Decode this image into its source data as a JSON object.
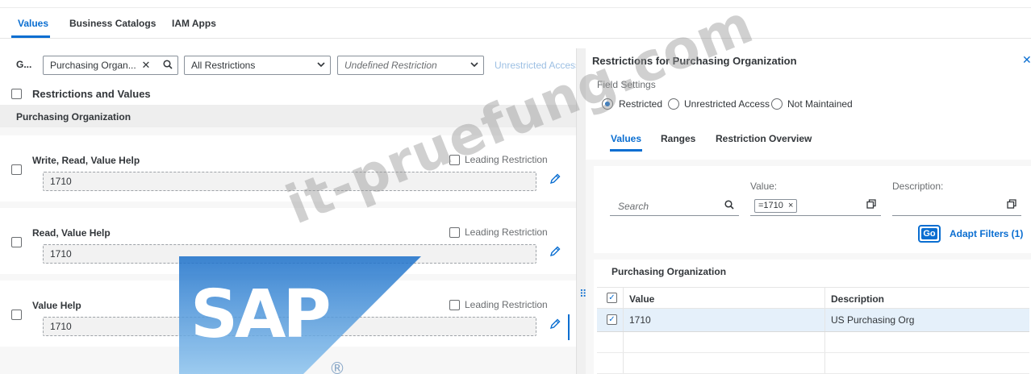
{
  "top_tabs": [
    {
      "label": "Values",
      "active": true
    },
    {
      "label": "Business Catalogs",
      "active": false
    },
    {
      "label": "IAM Apps",
      "active": false
    }
  ],
  "filterbar": {
    "group_label": "G...",
    "field_value": "Purchasing Organ...",
    "restrictions_select": "All Restrictions",
    "restriction_type_placeholder": "Undefined Restriction",
    "unrestricted_access": "Unrestricted Access"
  },
  "left": {
    "header": "Restrictions and Values",
    "section": "Purchasing Organization",
    "rows": [
      {
        "label": "Write, Read, Value Help",
        "leading": "Leading Restriction",
        "value": "1710"
      },
      {
        "label": "Read, Value Help",
        "leading": "Leading Restriction",
        "value": "1710"
      },
      {
        "label": "Value Help",
        "leading": "Leading Restriction",
        "value": "1710"
      }
    ]
  },
  "right": {
    "title": "Restrictions for Purchasing Organization",
    "field_settings": "Field Settings",
    "radios": [
      {
        "label": "Restricted",
        "selected": true
      },
      {
        "label": "Unrestricted Access",
        "selected": false
      },
      {
        "label": "Not Maintained",
        "selected": false
      }
    ],
    "tabs": [
      {
        "label": "Values",
        "active": true
      },
      {
        "label": "Ranges",
        "active": false
      },
      {
        "label": "Restriction Overview",
        "active": false
      }
    ],
    "filters": {
      "search_placeholder": "Search",
      "value_label": "Value:",
      "value_token": "=1710",
      "description_label": "Description:",
      "go": "Go",
      "adapt": "Adapt Filters (1)"
    },
    "table": {
      "title": "Purchasing Organization",
      "columns": [
        "Value",
        "Description"
      ],
      "rows": [
        {
          "value": "1710",
          "description": "US Purchasing Org",
          "selected": true
        }
      ]
    }
  },
  "watermark": {
    "text": "it-pruefung.com",
    "logo_text": "SAP",
    "registered": "®"
  },
  "colors": {
    "accent": "#0a6ed1",
    "selected_row": "#e5f0fa",
    "sap_blue": "#3d8fd9"
  }
}
